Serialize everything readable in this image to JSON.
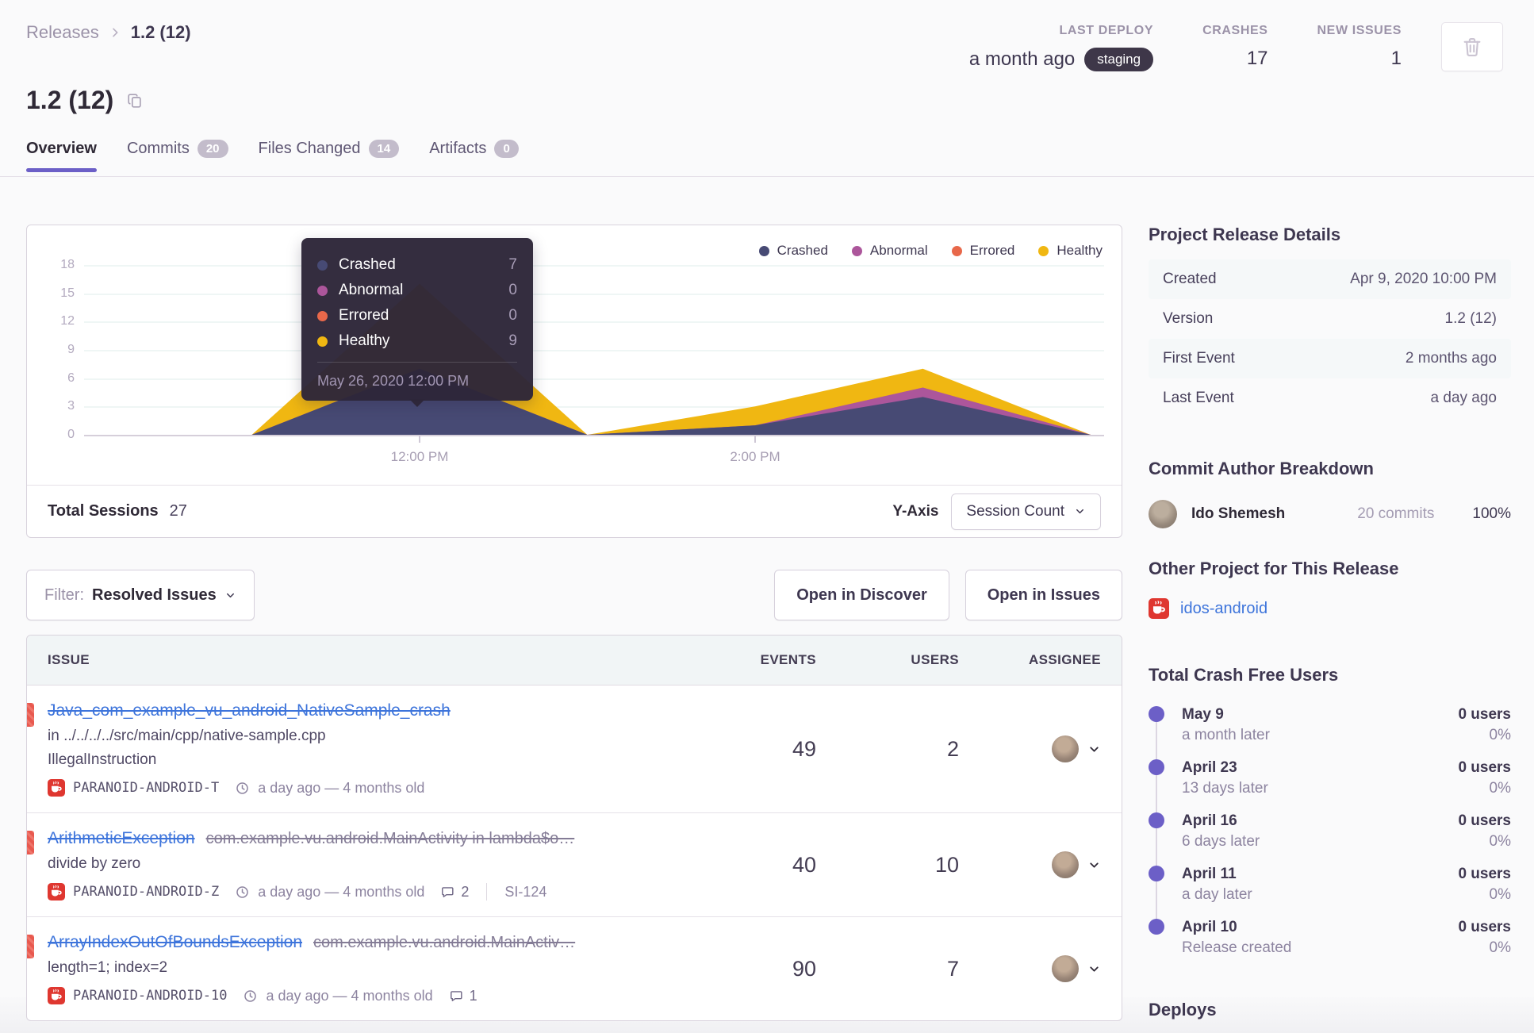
{
  "header": {
    "breadcrumb": {
      "parent": "Releases",
      "current": "1.2 (12)"
    },
    "stats": [
      {
        "label": "LAST DEPLOY",
        "value": "a month ago",
        "badge": "staging"
      },
      {
        "label": "CRASHES",
        "value": "17"
      },
      {
        "label": "NEW ISSUES",
        "value": "1"
      }
    ],
    "title": "1.2 (12)",
    "tabs": [
      {
        "label": "Overview"
      },
      {
        "label": "Commits",
        "count": "20"
      },
      {
        "label": "Files Changed",
        "count": "14"
      },
      {
        "label": "Artifacts",
        "count": "0"
      }
    ]
  },
  "chart": {
    "y_ticks": [
      "18",
      "15",
      "12",
      "9",
      "6",
      "3",
      "0"
    ],
    "x_ticks": [
      "12:00 PM",
      "2:00 PM"
    ],
    "tooltip": {
      "values": [
        "7",
        "0",
        "0",
        "9"
      ],
      "footer": "May 26, 2020 12:00 PM"
    },
    "footer": {
      "total_label": "Total Sessions",
      "total_value": "27",
      "y_axis_label": "Y-Axis",
      "y_axis_value": "Session Count"
    }
  },
  "chart_data": {
    "type": "area",
    "stacked": true,
    "title": "Release session health over time",
    "x": [
      "10:00 AM",
      "11:00 AM",
      "12:00 PM",
      "1:00 PM",
      "2:00 PM",
      "3:00 PM",
      "4:00 PM"
    ],
    "series": [
      {
        "name": "Crashed",
        "color": "#474A74",
        "values": [
          0,
          0,
          7,
          0,
          1,
          4,
          0
        ]
      },
      {
        "name": "Abnormal",
        "color": "#AC569B",
        "values": [
          0,
          0,
          0,
          0,
          0,
          1,
          0
        ]
      },
      {
        "name": "Errored",
        "color": "#E8684A",
        "values": [
          0,
          0,
          0,
          0,
          0,
          0,
          0
        ]
      },
      {
        "name": "Healthy",
        "color": "#F0B712",
        "values": [
          0,
          0,
          9,
          0,
          2,
          2,
          0
        ]
      }
    ],
    "ylim": [
      0,
      18
    ],
    "y_ticks": [
      0,
      3,
      6,
      9,
      12,
      15,
      18
    ],
    "x_axis_labels": [
      "12:00 PM",
      "2:00 PM"
    ],
    "legend_position": "top-right",
    "grid": true,
    "tooltip_point": {
      "time": "May 26, 2020 12:00 PM",
      "Crashed": 7,
      "Abnormal": 0,
      "Errored": 0,
      "Healthy": 9
    },
    "total_sessions": 27
  },
  "filter_bar": {
    "label": "Filter:",
    "value": "Resolved Issues",
    "open_discover": "Open in Discover",
    "open_issues": "Open in Issues"
  },
  "issues": {
    "columns": [
      "ISSUE",
      "EVENTS",
      "USERS",
      "ASSIGNEE"
    ],
    "rows": [
      {
        "title": "Java_com_example_vu_android_NativeSample_crash",
        "location": "in ../../../../src/main/cpp/native-sample.cpp",
        "message": "IllegalInstruction",
        "project": "PARANOID-ANDROID-T",
        "age": "a day ago — 4 months old",
        "events": "49",
        "users": "2"
      },
      {
        "title": "ArithmeticException",
        "culprit": "com.example.vu.android.MainActivity in lambda$o…",
        "message": "divide by zero",
        "project": "PARANOID-ANDROID-Z",
        "age": "a day ago — 4 months old",
        "comments": "2",
        "short_id": "SI-124",
        "events": "40",
        "users": "10"
      },
      {
        "title": "ArrayIndexOutOfBoundsException",
        "culprit": "com.example.vu.android.MainActiv…",
        "message": "length=1; index=2",
        "project": "PARANOID-ANDROID-10",
        "age": "a day ago — 4 months old",
        "comments": "1",
        "events": "90",
        "users": "7"
      }
    ]
  },
  "sidebar": {
    "details": {
      "title": "Project Release Details",
      "rows": [
        {
          "label": "Created",
          "value": "Apr 9, 2020 10:00 PM"
        },
        {
          "label": "Version",
          "value": "1.2 (12)"
        },
        {
          "label": "First Event",
          "value": "2 months ago"
        },
        {
          "label": "Last Event",
          "value": "a day ago"
        }
      ]
    },
    "authors": {
      "title": "Commit Author Breakdown",
      "rows": [
        {
          "name": "Ido Shemesh",
          "commits": "20 commits",
          "percent": "100%"
        }
      ]
    },
    "other_project": {
      "title": "Other Project for This Release",
      "project": "idos-android"
    },
    "crash_free": {
      "title": "Total Crash Free Users",
      "items": [
        {
          "date": "May 9",
          "sub": "a month later",
          "users": "0 users",
          "percent": "0%"
        },
        {
          "date": "April 23",
          "sub": "13 days later",
          "users": "0 users",
          "percent": "0%"
        },
        {
          "date": "April 16",
          "sub": "6 days later",
          "users": "0 users",
          "percent": "0%"
        },
        {
          "date": "April 11",
          "sub": "a day later",
          "users": "0 users",
          "percent": "0%"
        },
        {
          "date": "April 10",
          "sub": "Release created",
          "users": "0 users",
          "percent": "0%"
        }
      ]
    },
    "deploys_title": "Deploys"
  },
  "colors": {
    "accent": "#6C5FC7",
    "link": "#3D74DB",
    "crashed": "#474A74",
    "abnormal": "#AC569B",
    "errored": "#E8684A",
    "healthy": "#F0B712",
    "staging_badge_bg": "#3E3749",
    "unhandled_red": "#E8594F"
  }
}
